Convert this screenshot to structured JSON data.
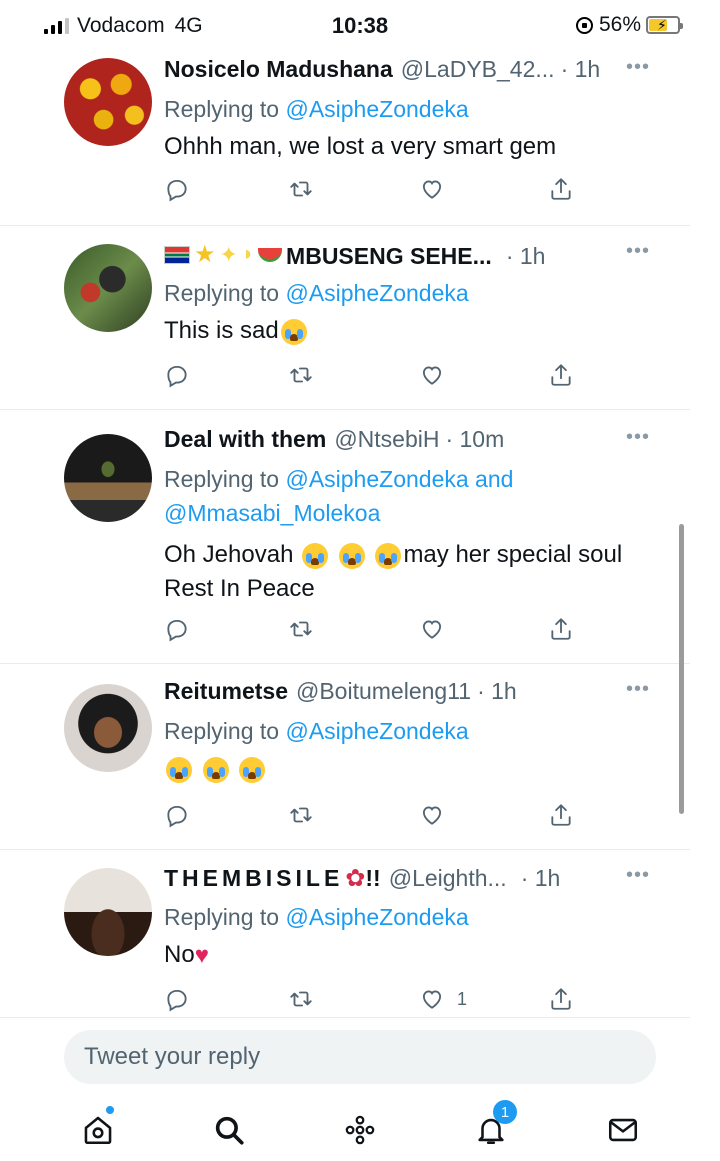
{
  "status_bar": {
    "carrier": "Vodacom",
    "network": "4G",
    "time": "10:38",
    "battery": "56%"
  },
  "tweets": [
    {
      "name": "Nosicelo Madushana",
      "handle": "@LaDYB_42...",
      "time": "· 1h",
      "replying_prefix": "Replying to",
      "replying_to": "@AsipheZondeka",
      "replying_and": "",
      "replying_to_2": "",
      "text": "Ohhh man, we lost a very smart gem",
      "likes": ""
    },
    {
      "name": "MBUSENG SEHE...",
      "handle": "",
      "time": "· 1h",
      "replying_prefix": "Replying to",
      "replying_to": "@AsipheZondeka",
      "replying_and": "",
      "replying_to_2": "",
      "text": "This is sad",
      "likes": ""
    },
    {
      "name": "Deal with them",
      "handle": "@NtsebiH",
      "time": "· 10m",
      "replying_prefix": "Replying to",
      "replying_to": "@AsipheZondeka",
      "replying_and": "and",
      "replying_to_2": "@Mmasabi_Molekoa",
      "text_before": "Oh Jehovah",
      "text_after": "may her special soul",
      "text_line2": "Rest In Peace",
      "likes": ""
    },
    {
      "name": "Reitumetse",
      "handle": "@Boitumeleng11",
      "time": "· 1h",
      "replying_prefix": "Replying to",
      "replying_to": "@AsipheZondeka",
      "replying_and": "",
      "replying_to_2": "",
      "text": "",
      "likes": ""
    },
    {
      "name": "THEMBISILE",
      "name_suffix": "!!",
      "handle": "@Leighth...",
      "time": "· 1h",
      "replying_prefix": "Replying to",
      "replying_to": "@AsipheZondeka",
      "replying_and": "",
      "replying_to_2": "",
      "text": "No",
      "likes": "1"
    }
  ],
  "more_glyph": "•••",
  "reply_box": {
    "placeholder": "Tweet your reply"
  },
  "bottom_nav": {
    "items": [
      "home-icon",
      "search-icon",
      "spaces-icon",
      "notifications-icon",
      "messages-icon"
    ],
    "notification_count": "1"
  },
  "colors": {
    "accent": "#1d9bf0",
    "muted": "#536471",
    "text": "#0f1419"
  }
}
